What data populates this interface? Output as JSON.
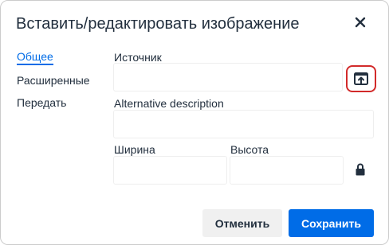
{
  "dialog": {
    "title": "Вставить/редактировать изображение",
    "close_icon": "close-icon"
  },
  "nav": {
    "items": [
      {
        "label": "Общее",
        "active": true
      },
      {
        "label": "Расширенные",
        "active": false
      },
      {
        "label": "Передать",
        "active": false
      }
    ]
  },
  "form": {
    "source_label": "Источник",
    "source_value": "",
    "browse_icon": "upload-icon",
    "alt_label": "Alternative description",
    "alt_value": "",
    "width_label": "Ширина",
    "width_value": "",
    "height_label": "Высота",
    "height_value": "",
    "lock_icon": "lock-icon"
  },
  "footer": {
    "cancel_label": "Отменить",
    "save_label": "Сохранить"
  },
  "colors": {
    "accent": "#006ce7",
    "highlight": "#d22a2a",
    "text": "#222f3e",
    "border": "#eeeeee"
  }
}
